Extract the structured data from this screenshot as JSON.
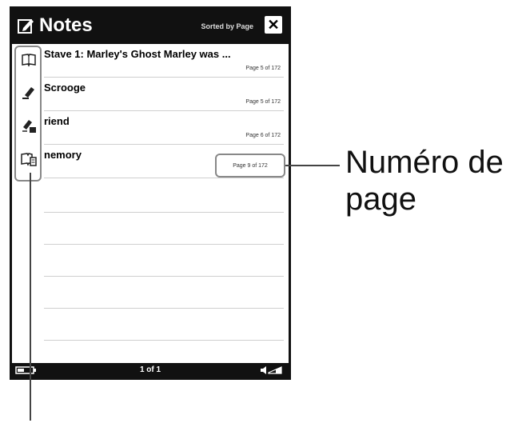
{
  "header": {
    "title": "Notes",
    "sort_label": "Sorted by Page",
    "close_label": "✕"
  },
  "notes": [
    {
      "text": "Stave 1: Marley's Ghost Marley was ...",
      "page": "Page 5 of 172"
    },
    {
      "text": "Scrooge",
      "page": "Page 5 of 172"
    },
    {
      "text": "riend",
      "page": "Page 6 of 172"
    },
    {
      "text": "nemory",
      "page": "Page 9 of 172"
    }
  ],
  "sidebar_icons": [
    "bookmark-icon",
    "highlight-pen-icon",
    "handwriting-note-icon",
    "text-note-icon"
  ],
  "footer": {
    "page_counter": "1 of 1"
  },
  "callout": {
    "label_line1": "Numéro de",
    "label_line2": "page"
  }
}
